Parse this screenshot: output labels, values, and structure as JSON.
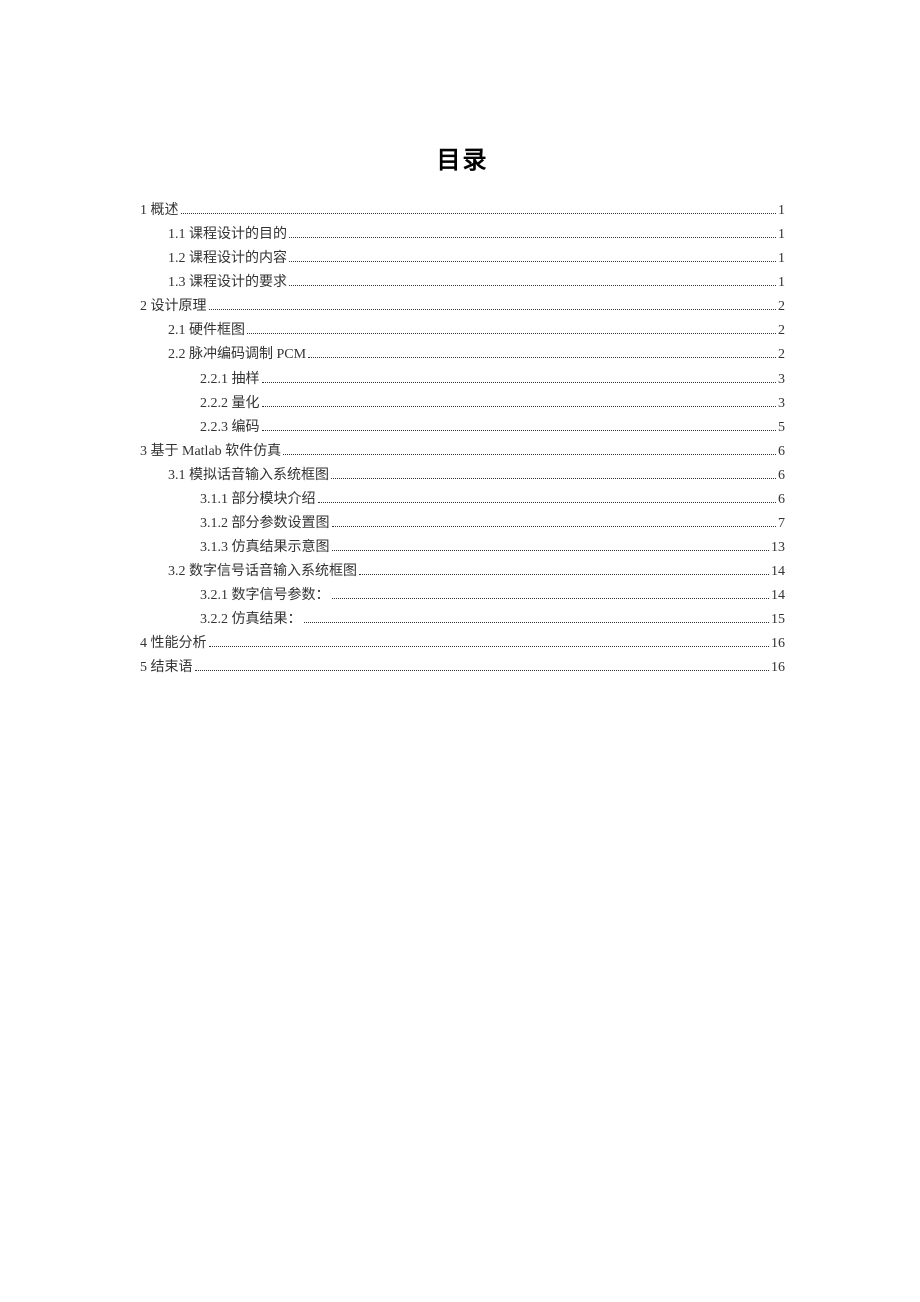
{
  "title": "目录",
  "toc": [
    {
      "level": 0,
      "label": "1 概述",
      "page": "1"
    },
    {
      "level": 1,
      "label": "1.1 课程设计的目的",
      "page": "1"
    },
    {
      "level": 1,
      "label": "1.2 课程设计的内容",
      "page": "1"
    },
    {
      "level": 1,
      "label": "1.3 课程设计的要求",
      "page": "1"
    },
    {
      "level": 0,
      "label": "2 设计原理",
      "page": "2"
    },
    {
      "level": 1,
      "label": "2.1 硬件框图",
      "page": "2"
    },
    {
      "level": 1,
      "label": "2.2 脉冲编码调制 PCM",
      "page": "2"
    },
    {
      "level": 2,
      "label": "2.2.1 抽样",
      "page": "3"
    },
    {
      "level": 2,
      "label": "2.2.2 量化",
      "page": "3"
    },
    {
      "level": 2,
      "label": "2.2.3 编码",
      "page": "5"
    },
    {
      "level": 0,
      "label": "3  基于 Matlab 软件仿真",
      "page": "6"
    },
    {
      "level": 1,
      "label": "3.1 模拟话音输入系统框图",
      "page": "6"
    },
    {
      "level": 2,
      "label": "3.1.1 部分模块介绍",
      "page": "6"
    },
    {
      "level": 2,
      "label": "3.1.2 部分参数设置图",
      "page": "7"
    },
    {
      "level": 2,
      "label": "3.1.3 仿真结果示意图",
      "page": "13"
    },
    {
      "level": 1,
      "label": "3.2 数字信号话音输入系统框图",
      "page": "14"
    },
    {
      "level": 2,
      "label": "3.2.1 数字信号参数：",
      "page": "14"
    },
    {
      "level": 2,
      "label": "3.2.2 仿真结果：",
      "page": "15"
    },
    {
      "level": 0,
      "label": "4 性能分析",
      "page": "16"
    },
    {
      "level": 0,
      "label": "5 结束语",
      "page": "16"
    }
  ]
}
